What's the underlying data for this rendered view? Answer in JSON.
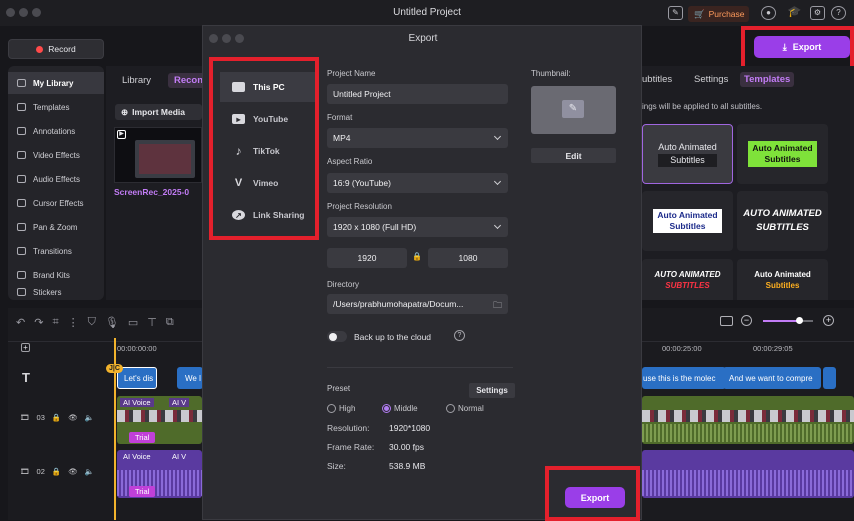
{
  "app": {
    "title": "Untitled Project",
    "purchase_label": "Purchase"
  },
  "header": {
    "record_label": "Record",
    "export_label": "Export"
  },
  "sidebar": {
    "items": [
      {
        "label": "My Library"
      },
      {
        "label": "Templates"
      },
      {
        "label": "Annotations"
      },
      {
        "label": "Video Effects"
      },
      {
        "label": "Audio Effects"
      },
      {
        "label": "Cursor Effects"
      },
      {
        "label": "Pan & Zoom"
      },
      {
        "label": "Transitions"
      },
      {
        "label": "Brand Kits"
      },
      {
        "label": "Stickers"
      }
    ]
  },
  "library": {
    "tab_library": "Library",
    "tab_recordings": "Recon",
    "import_label": "Import Media",
    "thumb_label": "ScreenRec_2025-0"
  },
  "right_panel": {
    "tabs": [
      "ubtitles",
      "Settings",
      "Templates"
    ],
    "note": "ings will be applied to all subtitles.",
    "templates": [
      {
        "line1": "Auto Animated",
        "line2": "Subtitles"
      },
      {
        "line1": "Auto Animated",
        "line2": "Subtitles"
      },
      {
        "line1": "Auto Animated",
        "line2": "Subtitles"
      },
      {
        "line1": "AUTO ANIMATED",
        "line2": "SUBTITLES"
      },
      {
        "line1": "AUTO ANIMATED",
        "line2": "SUBTITLES"
      },
      {
        "line1": "Auto Animated",
        "line2": "Subtitles"
      }
    ]
  },
  "timeline": {
    "time_start": "00:00:00:00",
    "time_mid": "00:00:25:00",
    "time_end": "00:00:29:05",
    "playhead_label": "J|C",
    "tracks": [
      {
        "number": "03"
      },
      {
        "number": "02"
      }
    ],
    "captions": [
      "Let's dis",
      "We l",
      "use this is the molec",
      "And we want to compre"
    ],
    "clip_labels": [
      "AI Voice",
      "AI V",
      "Trial"
    ]
  },
  "export_dialog": {
    "title": "Export",
    "destinations": [
      {
        "label": "This PC"
      },
      {
        "label": "YouTube"
      },
      {
        "label": "TikTok"
      },
      {
        "label": "Vimeo"
      },
      {
        "label": "Link Sharing"
      }
    ],
    "project_name_label": "Project Name",
    "project_name_value": "Untitled Project",
    "format_label": "Format",
    "format_value": "MP4",
    "aspect_label": "Aspect Ratio",
    "aspect_value": "16:9 (YouTube)",
    "resolution_label": "Project Resolution",
    "resolution_value": "1920 x 1080 (Full HD)",
    "width_value": "1920",
    "height_value": "1080",
    "directory_label": "Directory",
    "directory_value": "/Users/prabhumohapatra/Docum...",
    "cloud_label": "Back up to the cloud",
    "thumbnail_label": "Thumbnail:",
    "edit_label": "Edit",
    "preset_label": "Preset",
    "settings_label": "Settings",
    "preset_high": "High",
    "preset_middle": "Middle",
    "preset_normal": "Normal",
    "resolution_info_label": "Resolution:",
    "resolution_info_value": "1920*1080",
    "framerate_label": "Frame Rate:",
    "framerate_value": "30.00 fps",
    "size_label": "Size:",
    "size_value": "538.9 MB",
    "export_label": "Export"
  }
}
